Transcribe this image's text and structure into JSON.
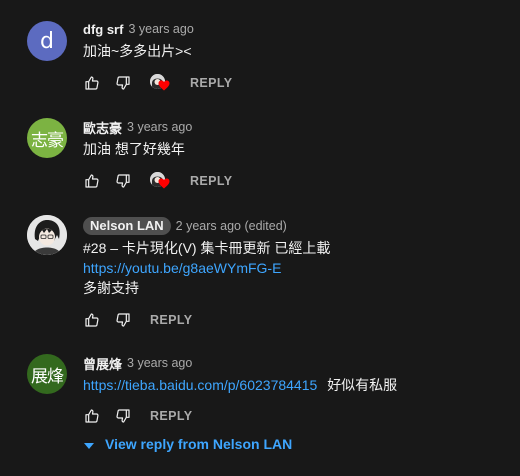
{
  "comments": [
    {
      "author": "dfg srf",
      "time": "3 years ago",
      "lines": [
        "加油~多多出片><"
      ],
      "reply_label": "REPLY",
      "avatar_text": "d",
      "avatar_color": "#5c6bc0",
      "creator_heart": true
    },
    {
      "author": "歐志豪",
      "time": "3 years ago",
      "lines": [
        "加油 想了好幾年"
      ],
      "reply_label": "REPLY",
      "avatar_text": "志豪",
      "avatar_color": "#7cb342",
      "creator_heart": true
    },
    {
      "author": "Nelson LAN",
      "time": "2 years ago (edited)",
      "lines": [
        "#28 – 卡片現化(V) 集卡冊更新 已經上載",
        "https://youtu.be/g8aeWYmFG-E",
        "多謝支持"
      ],
      "reply_label": "REPLY",
      "avatar_type": "photo",
      "is_creator": true
    },
    {
      "author": "曾展烽",
      "time": "3 years ago",
      "link": "https://tieba.baidu.com/p/6023784415",
      "after_link": "好似有私服",
      "reply_label": "REPLY",
      "avatar_text": "展烽",
      "avatar_color": "#33691e"
    }
  ],
  "view_replies": {
    "label": "View reply from Nelson LAN",
    "icon": "caret-down-icon"
  },
  "colors": {
    "background": "#181818",
    "link": "#3ea6ff",
    "heart": "#ff0000",
    "secondary_text": "#aaaaaa"
  },
  "icons": [
    "thumbs-up-icon",
    "thumbs-down-icon",
    "creator-heart-icon"
  ]
}
